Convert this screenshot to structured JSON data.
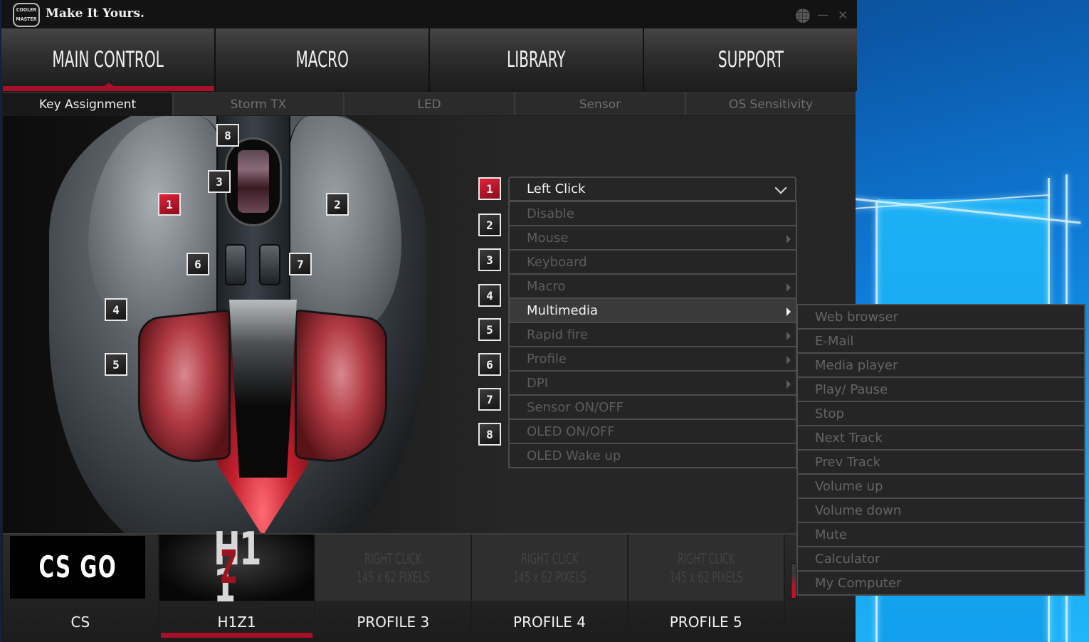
{
  "window": {
    "title": "Make It Yours.",
    "logo_line1": "COOLER",
    "logo_line2": "MASTER",
    "controls": [
      "language-globe",
      "minimize",
      "close"
    ],
    "minimize_glyph": "—",
    "close_glyph": "✕"
  },
  "main_tabs": [
    {
      "label": "MAIN CONTROL",
      "active": true
    },
    {
      "label": "MACRO",
      "active": false
    },
    {
      "label": "LIBRARY",
      "active": false
    },
    {
      "label": "SUPPORT",
      "active": false
    }
  ],
  "sub_tabs": [
    {
      "label": "Key Assignment",
      "active": true
    },
    {
      "label": "Storm TX",
      "active": false
    },
    {
      "label": "LED",
      "active": false
    },
    {
      "label": "Sensor",
      "active": false
    },
    {
      "label": "OS Sensitivity",
      "active": false
    }
  ],
  "mouse_buttons": {
    "selected": "1",
    "labels": [
      "1",
      "2",
      "3",
      "4",
      "5",
      "6",
      "7",
      "8"
    ]
  },
  "assignment": {
    "selected_value": "Left Click",
    "menu": [
      {
        "label": "Disable",
        "submenu": false,
        "active": false
      },
      {
        "label": "Mouse",
        "submenu": true,
        "active": false
      },
      {
        "label": "Keyboard",
        "submenu": false,
        "active": false
      },
      {
        "label": "Macro",
        "submenu": true,
        "active": false
      },
      {
        "label": "Multimedia",
        "submenu": true,
        "active": true
      },
      {
        "label": "Rapid fire",
        "submenu": true,
        "active": false
      },
      {
        "label": "Profile",
        "submenu": true,
        "active": false
      },
      {
        "label": "DPI",
        "submenu": true,
        "active": false
      },
      {
        "label": "Sensor ON/OFF",
        "submenu": false,
        "active": false
      },
      {
        "label": "OLED ON/OFF",
        "submenu": false,
        "active": false
      },
      {
        "label": "OLED Wake up",
        "submenu": false,
        "active": false
      }
    ],
    "multimedia_submenu": [
      "Web browser",
      "E-Mail",
      "Media player",
      "Play/ Pause",
      "Stop",
      "Next Track",
      "Prev Track",
      "Volume up",
      "Volume down",
      "Mute",
      "Calculator",
      "My Computer"
    ]
  },
  "profiles": [
    {
      "name": "CS",
      "thumb": "CS GO",
      "active": false
    },
    {
      "name": "H1Z1",
      "thumb": "H1Z1",
      "active": true
    },
    {
      "name": "PROFILE 3",
      "placeholder_line1": "RIGHT CLICK",
      "placeholder_line2": "145 x 62 PIXELS",
      "active": false
    },
    {
      "name": "PROFILE 4",
      "placeholder_line1": "RIGHT CLICK",
      "placeholder_line2": "145 x 62 PIXELS",
      "active": false
    },
    {
      "name": "PROFILE 5",
      "placeholder_line1": "RIGHT CLICK",
      "placeholder_line2": "145 x 62 PIXELS",
      "active": false
    }
  ],
  "colors": {
    "accent_red": "#a8102a",
    "window_bg": "#1b1b1b",
    "menu_text_dim": "#5c5c5c",
    "desktop_blue": "#0f7ad6"
  }
}
